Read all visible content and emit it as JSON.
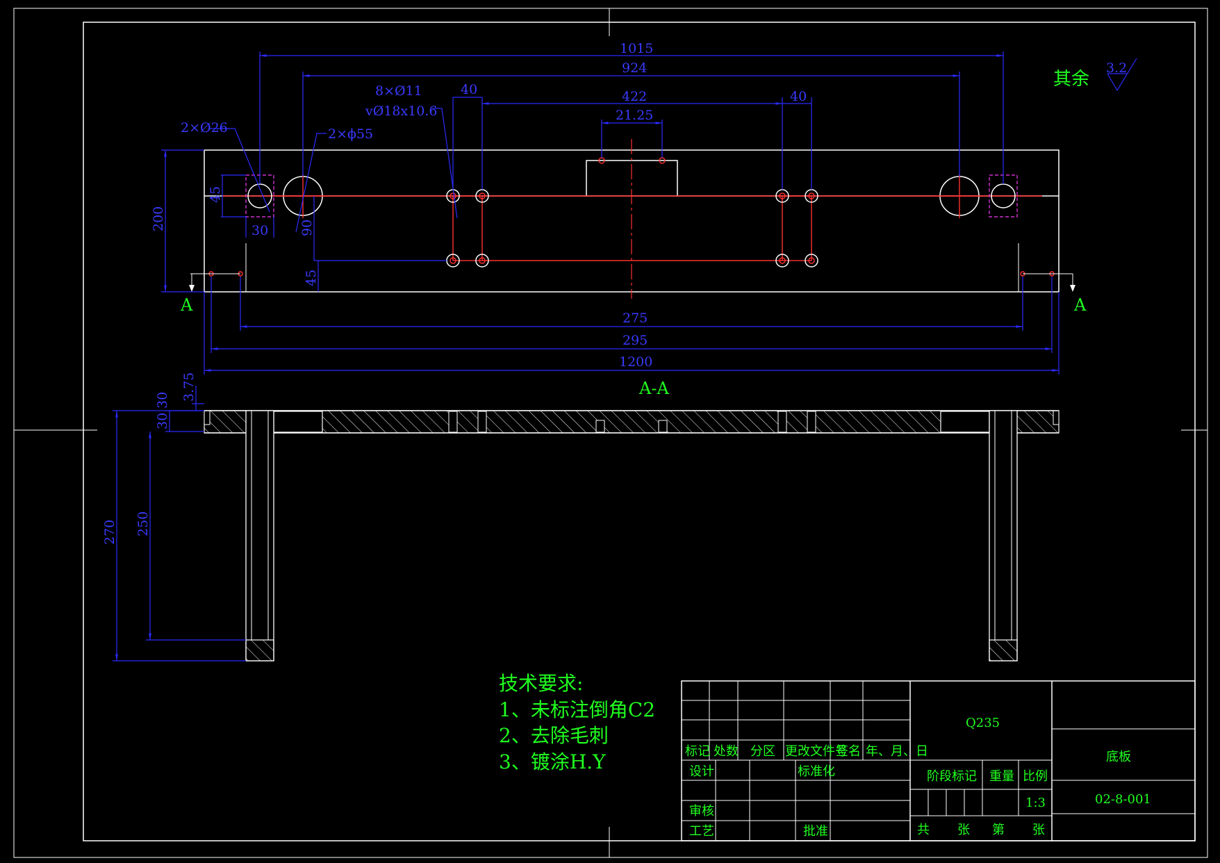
{
  "roughness": {
    "label": "其余",
    "value": "3.2"
  },
  "dimensions": {
    "d1015": "1015",
    "d924": "924",
    "d40a": "40",
    "d422": "422",
    "d40b": "40",
    "d2125": "21.25",
    "holes_small": "8×Ø11",
    "holes_cbore": "vØ18x10.6",
    "holes_26": "2×Ø26",
    "holes_55": "2×ϕ55",
    "d45a": "45",
    "d200": "200",
    "d30a": "30",
    "d90": "90",
    "d45b": "45",
    "d275": "275",
    "d295": "295",
    "d1200": "1200",
    "d375": "3.75",
    "d30b": "30",
    "d30c": "30",
    "d270": "270",
    "d250": "250"
  },
  "section": {
    "markLeft": "A",
    "markRight": "A",
    "title": "A-A"
  },
  "tech": {
    "title": "技术要求:",
    "items": [
      "1、未标注倒角C2",
      "2、去除毛刺",
      "3、镀涂H.Y"
    ]
  },
  "titleblock": {
    "material": "Q235",
    "part_name": "底板",
    "drawing_no": "02-8-001",
    "scale_label": "比例",
    "scale": "1:3",
    "stage_mark": "阶段标记",
    "weight": "重量",
    "rev_headers": [
      "标记",
      "处数",
      "分区",
      "更改文件号",
      "签名",
      "年、月、日"
    ],
    "design": "设计",
    "standardize": "标准化",
    "review": "审核",
    "process": "工艺",
    "approve": "批准",
    "sheets": [
      "共",
      "张",
      "第",
      "张"
    ]
  },
  "colors": {
    "outline": "#ffffff",
    "center": "#ff3030",
    "dimension": "#2b2bff",
    "text": "#20ff20",
    "hidden": "#d030d0"
  }
}
